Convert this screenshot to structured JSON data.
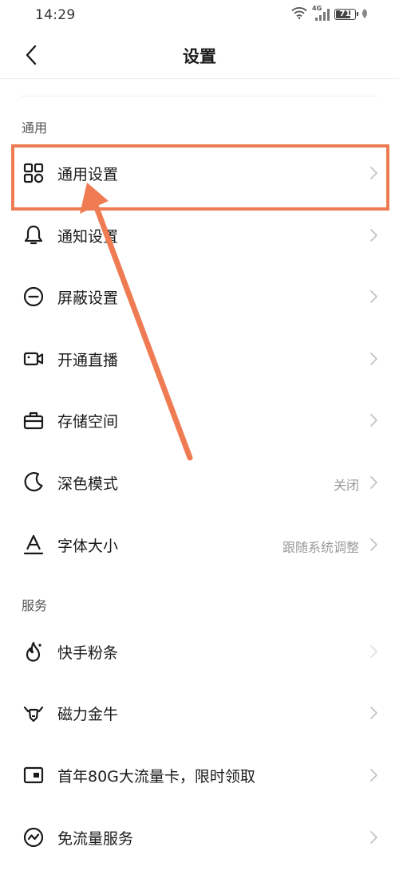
{
  "status_bar": {
    "time": "14:29",
    "network": "4G",
    "battery": "71"
  },
  "header": {
    "title": "设置"
  },
  "sections": {
    "general": {
      "label": "通用",
      "items": [
        {
          "label": "通用设置",
          "icon": "grid-icon"
        },
        {
          "label": "通知设置",
          "icon": "bell-icon"
        },
        {
          "label": "屏蔽设置",
          "icon": "block-icon"
        },
        {
          "label": "开通直播",
          "icon": "video-camera-icon"
        },
        {
          "label": "存储空间",
          "icon": "storage-box-icon"
        },
        {
          "label": "深色模式",
          "icon": "moon-icon",
          "value": "关闭"
        },
        {
          "label": "字体大小",
          "icon": "font-size-icon",
          "value": "跟随系统调整"
        }
      ]
    },
    "services": {
      "label": "服务",
      "items": [
        {
          "label": "快手粉条",
          "icon": "flame-icon"
        },
        {
          "label": "磁力金牛",
          "icon": "bull-icon"
        },
        {
          "label": "首年80G大流量卡，限时领取",
          "icon": "sim-card-icon"
        },
        {
          "label": "免流量服务",
          "icon": "data-wave-icon"
        }
      ]
    }
  },
  "annotation": {
    "color": "#ef7b53"
  }
}
